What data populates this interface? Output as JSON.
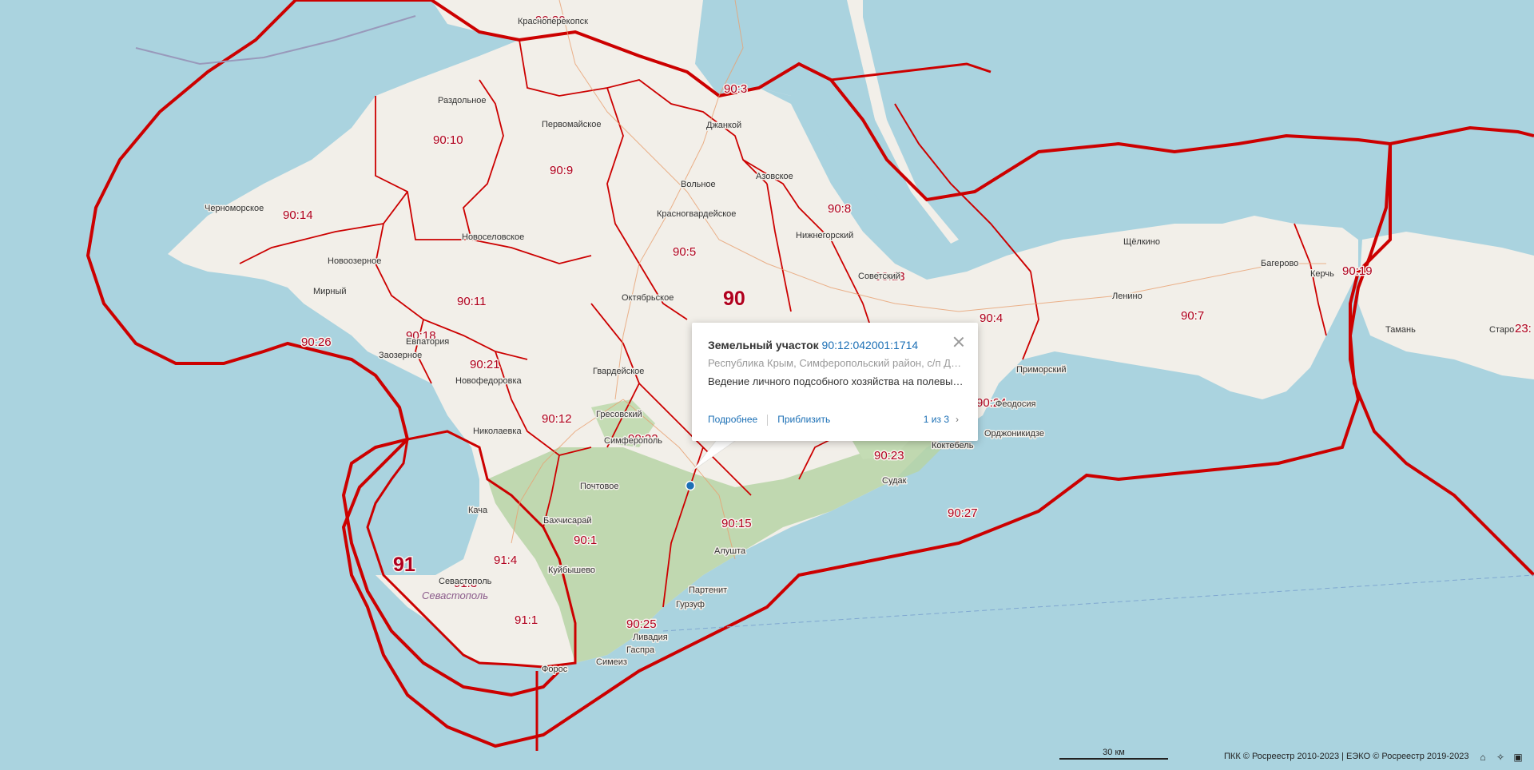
{
  "map": {
    "region_labels": [
      "90",
      "91"
    ],
    "district_labels": [
      "90:20",
      "90:3",
      "90:10",
      "90:9",
      "90:14",
      "90:8",
      "90:5",
      "90:13",
      "90:11",
      "90:18",
      "90:26",
      "90:21",
      "90:4",
      "90:7",
      "90:19",
      "90:24",
      "90:12",
      "90:22",
      "90:23",
      "90:15",
      "90:1",
      "90:27",
      "91:4",
      "91:3",
      "91:1",
      "90:25",
      "23:"
    ],
    "town_labels": [
      "Красноперекопск",
      "Раздольное",
      "Первомайское",
      "Джанкой",
      "Черноморское",
      "Вольное",
      "Азовское",
      "Красногвардейское",
      "Новоселовское",
      "Нижнегорский",
      "Новоозерное",
      "Мирный",
      "Советский",
      "Октябрьское",
      "Евпатория",
      "Заозерное",
      "Щёлкино",
      "Багерово",
      "Ленино",
      "Керчь",
      "Тамань",
      "Старо",
      "Приморский",
      "Новофедоровка",
      "Гвардейское",
      "Гресовский",
      "Николаевка",
      "Симферополь",
      "Феодосия",
      "Коктебель",
      "Орджоникидзе",
      "Почтовое",
      "Судак",
      "Кача",
      "Бахчисарай",
      "Куйбышево",
      "Алушта",
      "Партенит",
      "Гурзуф",
      "Ливадия",
      "Гаспра",
      "Симеиз",
      "Форос",
      "Севастополь"
    ],
    "italic_city": "Севастополь"
  },
  "popup": {
    "title_prefix": "Земельный участок",
    "cadastral_number": "90:12:042001:1714",
    "address": "Республика Крым, Симферопольский район, с/п До...",
    "purpose": "Ведение личного подсобного хозяйства на полевых...",
    "details_link": "Подробнее",
    "zoom_link": "Приблизить",
    "pager": "1 из 3"
  },
  "footer": {
    "scale_label": "30 км",
    "attribution": "ПКК © Росреестр 2010-2023 | ЕЭКО © Росреестр 2019-2023",
    "icons": [
      "home-icon",
      "locate-icon",
      "screenshot-icon"
    ]
  },
  "colors": {
    "sea": "#aad3df",
    "land": "#f2efe9",
    "forest": "#b7d3a6",
    "boundary": "#cc0000"
  }
}
